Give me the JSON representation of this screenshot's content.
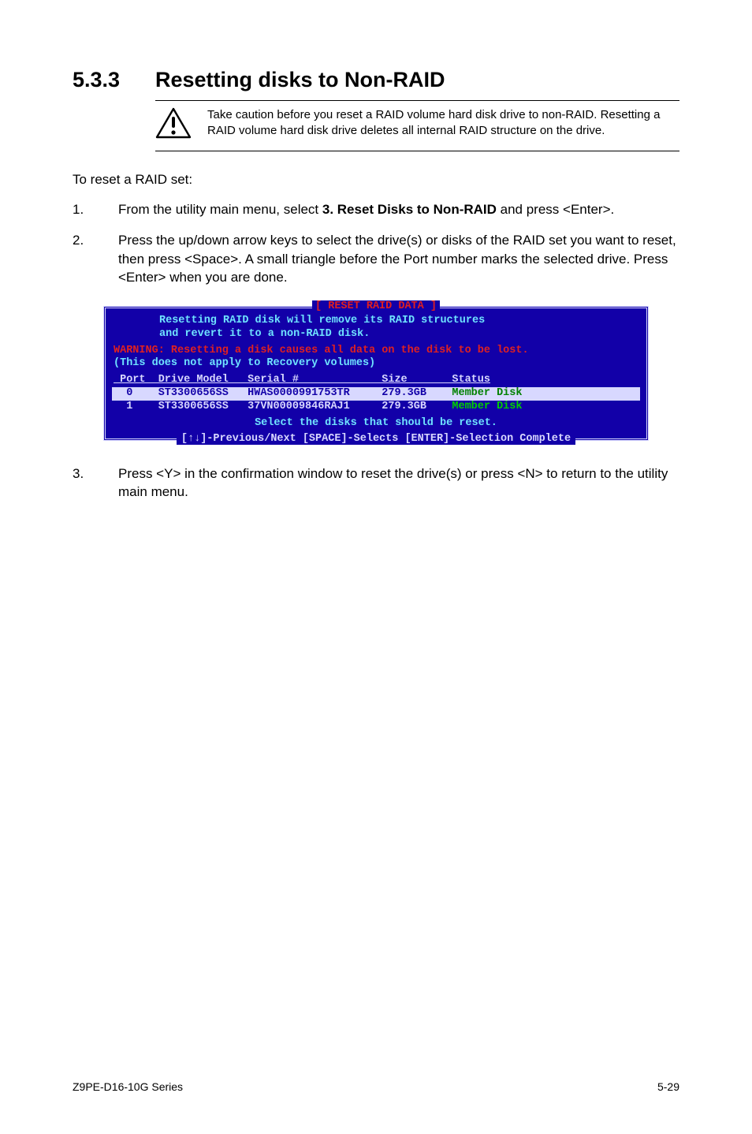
{
  "section": {
    "number": "5.3.3",
    "title": "Resetting disks to Non-RAID"
  },
  "caution_note": "Take caution before you reset a RAID volume hard disk drive to non-RAID. Resetting a RAID volume hard disk drive deletes all internal RAID structure on the drive.",
  "lead": "To reset a RAID set:",
  "steps": {
    "s1": {
      "num": "1.",
      "prefix": "From the utility main menu, select ",
      "bold": "3. Reset Disks to Non-RAID",
      "suffix": " and press <Enter>."
    },
    "s2": {
      "num": "2.",
      "text": "Press the up/down arrow keys to select the drive(s) or disks of the RAID set you want to reset, then press <Space>. A small triangle before the Port number marks the selected drive. Press <Enter> when you are done."
    },
    "s3": {
      "num": "3.",
      "text": "Press <Y> in the confirmation window to reset the drive(s) or press <N> to return to the utility main menu."
    }
  },
  "terminal": {
    "title": "[ RESET RAID DATA ]",
    "msg1": "Resetting RAID disk will remove its RAID structures",
    "msg2": "and revert it to a non-RAID disk.",
    "warn": "WARNING: Resetting a disk causes all data on the disk to be lost.",
    "warn2": "(This does not apply to Recovery volumes)",
    "header": " Port  Drive Model   Serial #             Size       Status",
    "row0": "  0    ST3300656SS   HWAS0000991753TR     279.3GB    ",
    "row0_status": "Member Disk",
    "row1": "  1    ST3300656SS   37VN00009846RAJ1     279.3GB    ",
    "row1_status": "Member Disk",
    "select_prompt": "Select the disks that should be reset.",
    "legend": "[↑↓]-Previous/Next [SPACE]-Selects [ENTER]-Selection Complete"
  },
  "footer": {
    "left": "Z9PE-D16-10G Series",
    "right": "5-29"
  },
  "chart_data": {
    "type": "table",
    "title": "RESET RAID DATA",
    "columns": [
      "Port",
      "Drive Model",
      "Serial #",
      "Size",
      "Status"
    ],
    "rows": [
      {
        "Port": 0,
        "Drive Model": "ST3300656SS",
        "Serial #": "HWAS0000991753TR",
        "Size": "279.3GB",
        "Status": "Member Disk",
        "selected": true
      },
      {
        "Port": 1,
        "Drive Model": "ST3300656SS",
        "Serial #": "37VN00009846RAJ1",
        "Size": "279.3GB",
        "Status": "Member Disk",
        "selected": false
      }
    ]
  }
}
